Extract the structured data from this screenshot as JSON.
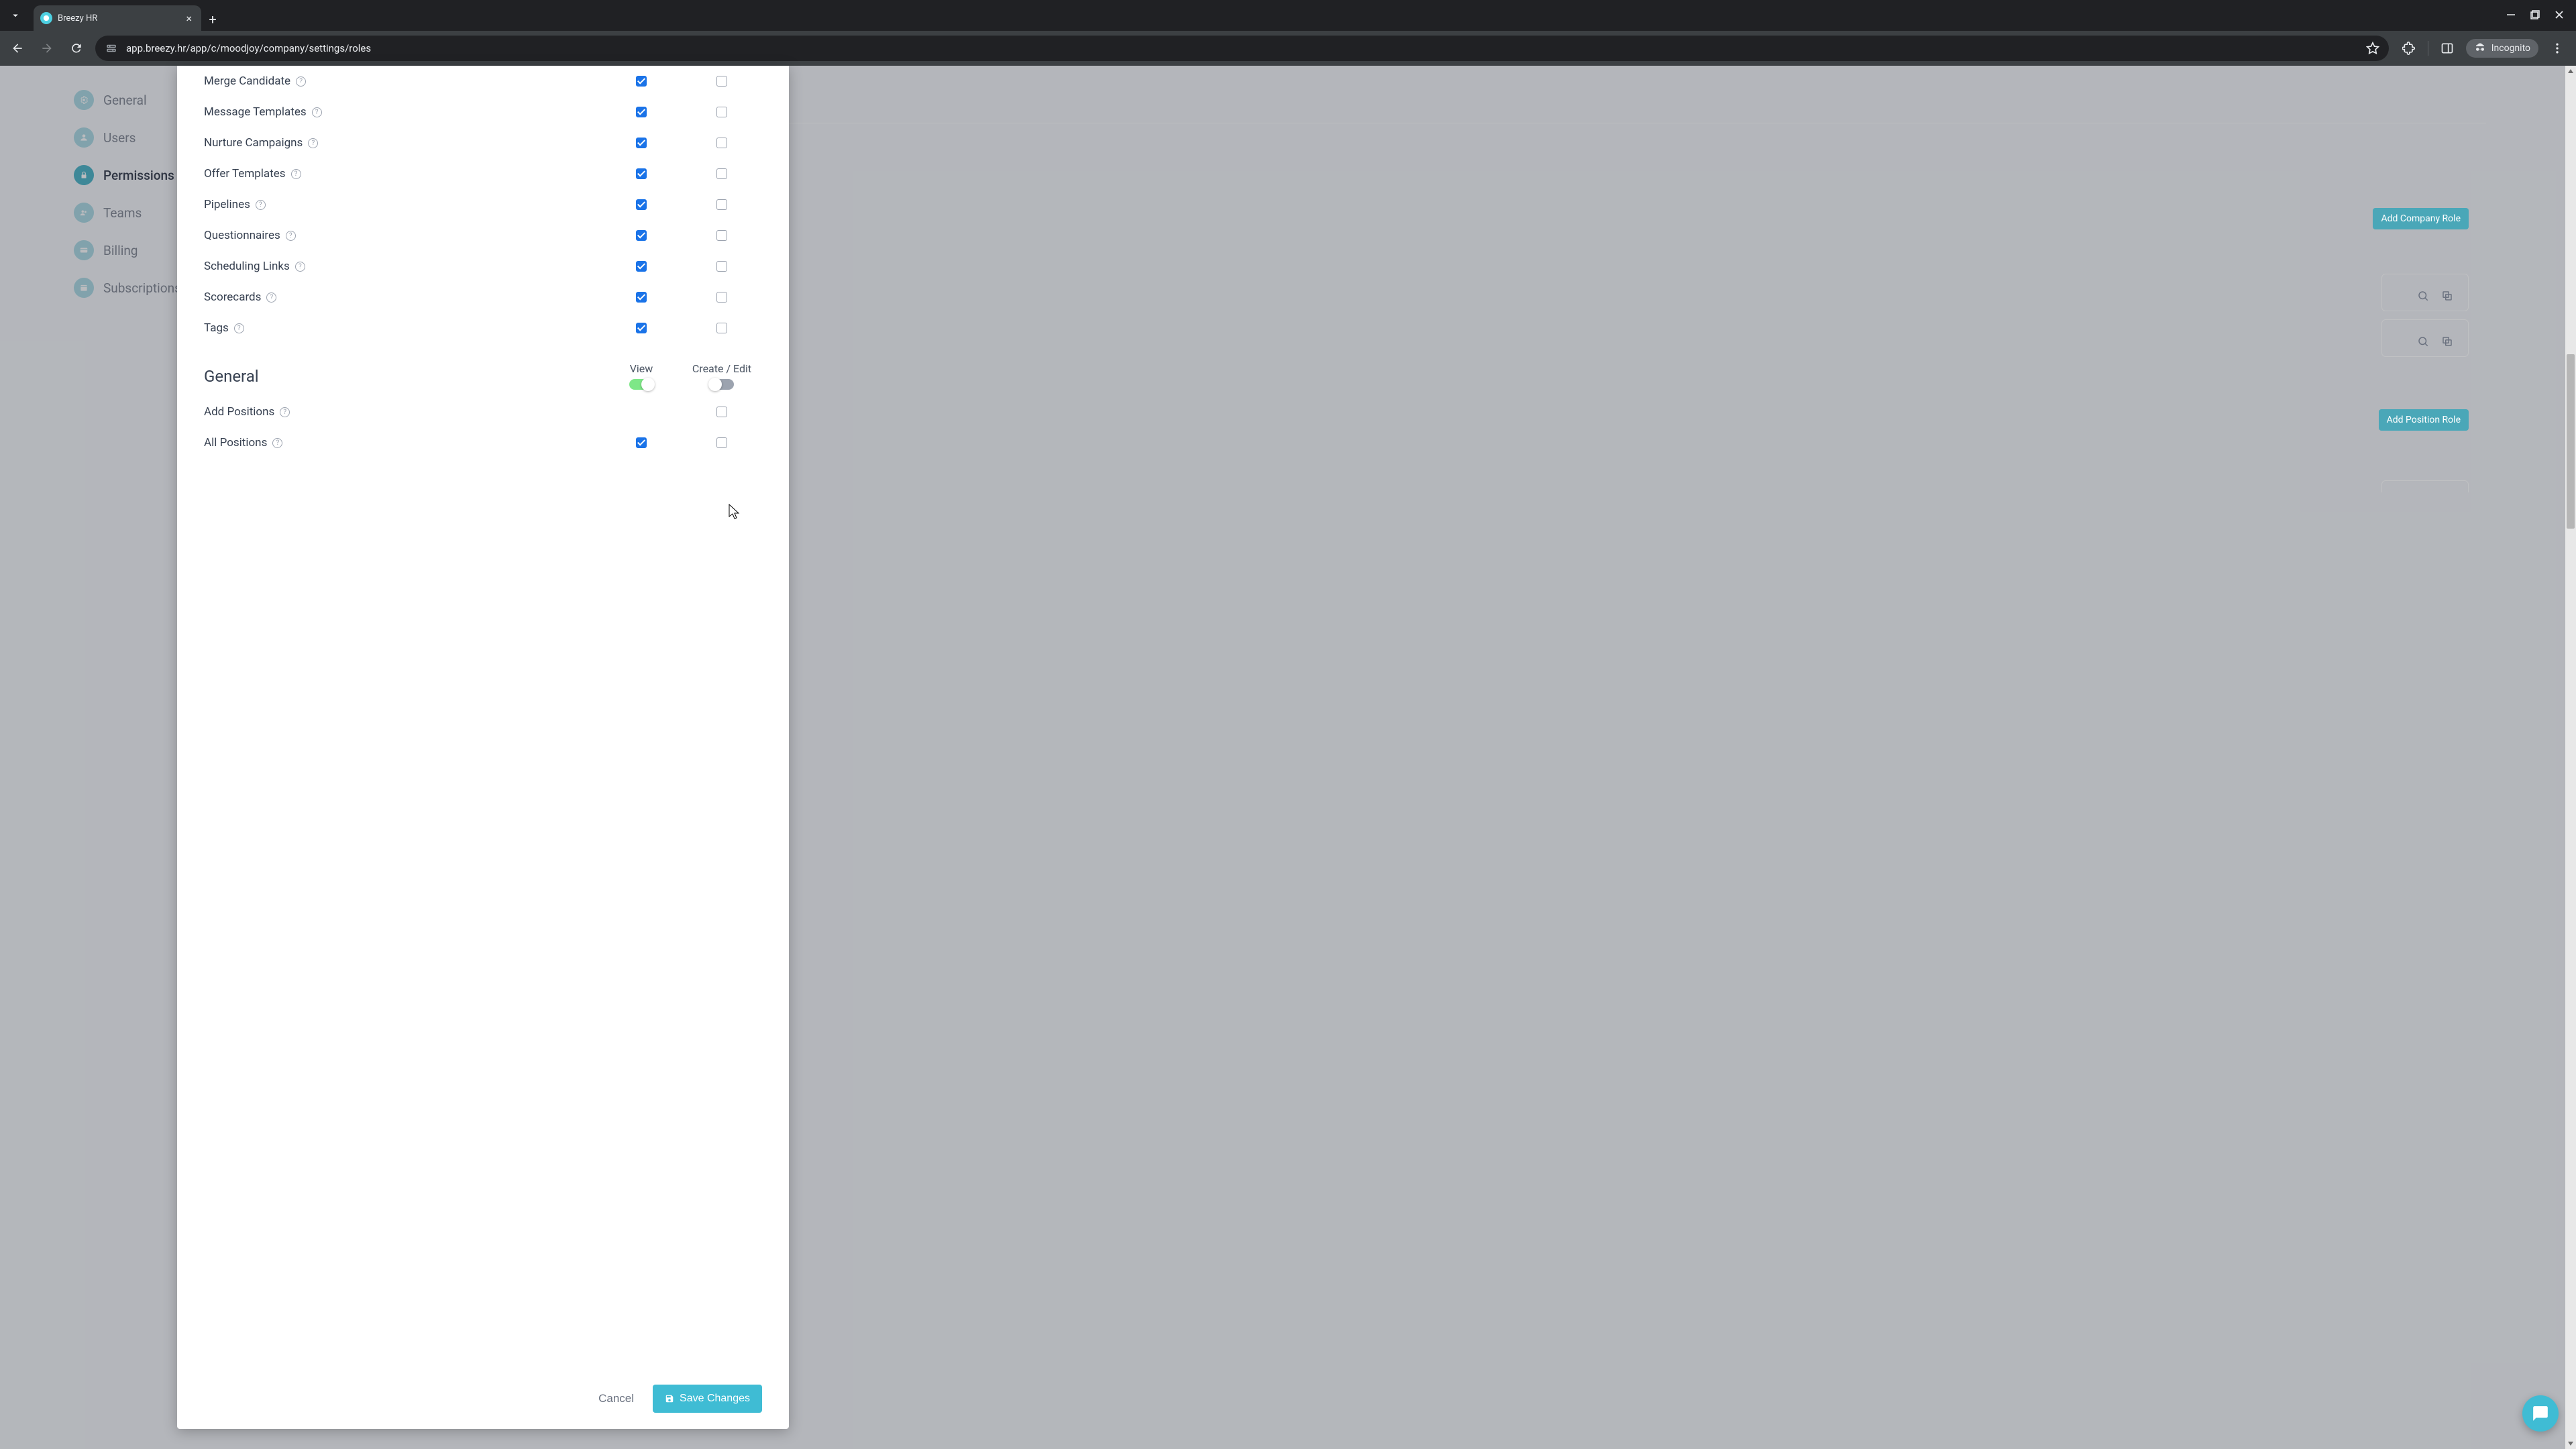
{
  "browser": {
    "tab_title": "Breezy HR",
    "url": "app.breezy.hr/app/c/moodjoy/company/settings/roles",
    "incognito_label": "Incognito"
  },
  "sidebar": {
    "items": [
      {
        "label": "General"
      },
      {
        "label": "Users"
      },
      {
        "label": "Permissions"
      },
      {
        "label": "Teams"
      },
      {
        "label": "Billing"
      },
      {
        "label": "Subscriptions"
      }
    ]
  },
  "bg_buttons": {
    "add_company_role": "Add Company Role",
    "add_position_role": "Add Position Role"
  },
  "modal": {
    "perm_rows": [
      {
        "label": "Merge Candidate",
        "view": true,
        "edit": false
      },
      {
        "label": "Message Templates",
        "view": true,
        "edit": false
      },
      {
        "label": "Nurture Campaigns",
        "view": true,
        "edit": false
      },
      {
        "label": "Offer Templates",
        "view": true,
        "edit": false
      },
      {
        "label": "Pipelines",
        "view": true,
        "edit": false
      },
      {
        "label": "Questionnaires",
        "view": true,
        "edit": false
      },
      {
        "label": "Scheduling Links",
        "view": true,
        "edit": false
      },
      {
        "label": "Scorecards",
        "view": true,
        "edit": false
      },
      {
        "label": "Tags",
        "view": true,
        "edit": false
      }
    ],
    "section_title": "General",
    "col_view": "View",
    "col_edit": "Create / Edit",
    "view_toggle_on": true,
    "edit_toggle_on": false,
    "general_rows": [
      {
        "label": "Add Positions",
        "view": null,
        "edit": false
      },
      {
        "label": "All Positions",
        "view": true,
        "edit": false
      }
    ],
    "cancel_label": "Cancel",
    "save_label": "Save Changes"
  }
}
